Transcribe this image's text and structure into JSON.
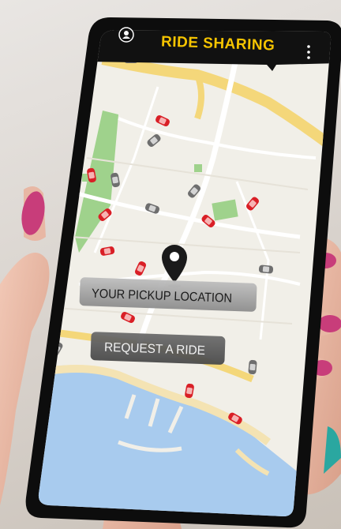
{
  "app": {
    "title": "RIDE SHARING",
    "accent_color": "#f5c400",
    "topbar_color": "#111111"
  },
  "header": {
    "profile_icon": "user-circle-icon",
    "menu_icon": "vertical-dots-icon"
  },
  "map": {
    "pin_icon": "map-pin-icon",
    "car_colors": {
      "available": "#d91f26",
      "other": "#6e6e6e"
    },
    "water_color": "#a8cbee",
    "park_color": "#9fd28c",
    "road_color": "#f4d77a"
  },
  "pickup": {
    "label": "YOUR PICKUP LOCATION"
  },
  "request": {
    "label": "REQUEST A RIDE"
  }
}
